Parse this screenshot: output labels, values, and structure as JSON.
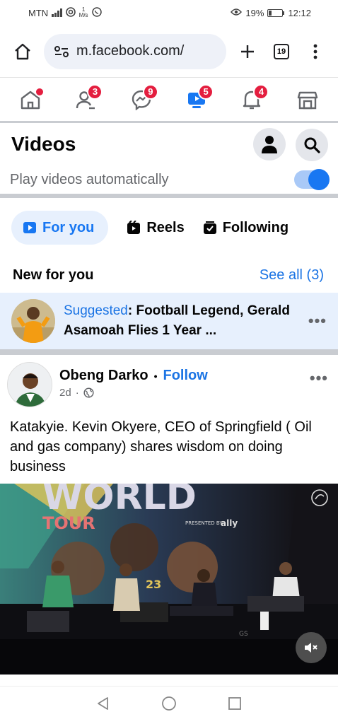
{
  "status_bar": {
    "carrier": "MTN",
    "speed_value": "1",
    "speed_unit": "M/s",
    "battery": "19%",
    "time": "12:12"
  },
  "browser": {
    "url": "m.facebook.com/",
    "tab_count": "19"
  },
  "fb_nav": {
    "friends_badge": "3",
    "messenger_badge": "9",
    "video_badge": "5",
    "notifications_badge": "4"
  },
  "videos": {
    "title": "Videos",
    "autoplay_label": "Play videos automatically",
    "autoplay_on": true
  },
  "tabs": [
    {
      "label": "For you",
      "active": true
    },
    {
      "label": "Reels",
      "active": false
    },
    {
      "label": "Following",
      "active": false
    }
  ],
  "new_for_you": {
    "heading": "New for you",
    "see_all": "See all (3)"
  },
  "suggested": {
    "label": "Suggested",
    "title": ": Football Legend, Gerald Asamoah Flies 1 Year ..."
  },
  "post": {
    "author": "Obeng Darko",
    "separator": "•",
    "follow": "Follow",
    "time": "2d",
    "time_sep": "·",
    "text": "Katakyie. Kevin Okyere, CEO of  Springfield ( Oil and gas company) shares wisdom on doing business",
    "video": {
      "banner_text": "WORLD",
      "tour_text": "TOUR",
      "presented_by": "PRESENTED BY",
      "sponsor": "ally",
      "number": "23"
    }
  },
  "colors": {
    "brand": "#1877f2",
    "badge": "#e41e3f",
    "link": "#1b74e4"
  }
}
